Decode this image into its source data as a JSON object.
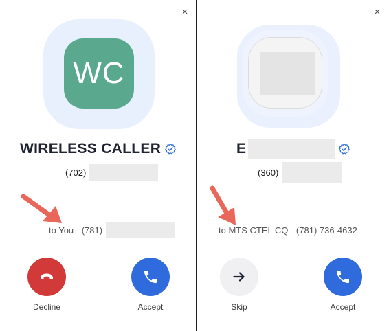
{
  "colors": {
    "accent": "#2f6bdc",
    "decline": "#d23a3a",
    "skip_bg": "#f0f0f3",
    "avatar_bg": "#5aa98e",
    "avatar_halo": "#e9f0fd",
    "annotation_arrow": "#e8675a"
  },
  "left_card": {
    "close_label": "×",
    "avatar_initials": "WC",
    "caller_name": "WIRELESS CALLER",
    "verified_icon": "verified-badge-icon",
    "phone_prefix": "(702)",
    "to_line": "to You - (781)",
    "decline_label": "Decline",
    "decline_icon": "hang-up-icon",
    "accept_label": "Accept",
    "accept_icon": "phone-icon"
  },
  "right_card": {
    "close_label": "×",
    "caller_name": "E",
    "verified_icon": "verified-badge-icon",
    "phone_prefix": "(360)",
    "to_line": "to MTS CTEL CQ - (781) 736-4632",
    "skip_label": "Skip",
    "skip_icon": "arrow-right-icon",
    "accept_label": "Accept",
    "accept_icon": "phone-icon"
  }
}
